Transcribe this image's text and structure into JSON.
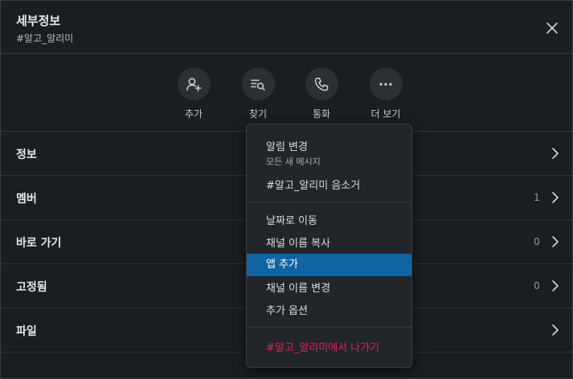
{
  "header": {
    "title": "세부정보",
    "channel": "#알고_알리미"
  },
  "icons": {
    "close": "close-icon",
    "add": "add-person-icon",
    "find": "search-list-icon",
    "call": "phone-icon",
    "more": "more-horizontal-icon",
    "chevron": "chevron-right-icon"
  },
  "actions": [
    {
      "label": "추가"
    },
    {
      "label": "찾기"
    },
    {
      "label": "통화"
    },
    {
      "label": "더 보기"
    }
  ],
  "rows": [
    {
      "label": "정보",
      "count": ""
    },
    {
      "label": "멤버",
      "count": "1"
    },
    {
      "label": "바로 가기",
      "count": "0"
    },
    {
      "label": "고정됨",
      "count": "0"
    },
    {
      "label": "파일",
      "count": ""
    }
  ],
  "menu": {
    "notification": "알림 변경",
    "notification_sub": "모든 새 메시지",
    "mute": "#알고_알리미 음소거",
    "jump_date": "날짜로 이동",
    "copy_name": "채널 이름 복사",
    "add_app": "앱 추가",
    "rename": "채널 이름 변경",
    "more_options": "추가 옵션",
    "leave": "#알고_알리미에서 나가기"
  },
  "colors": {
    "background": "#1a1d21",
    "menu_bg": "#222529",
    "highlight": "#1164a3",
    "danger": "#e0245e"
  }
}
